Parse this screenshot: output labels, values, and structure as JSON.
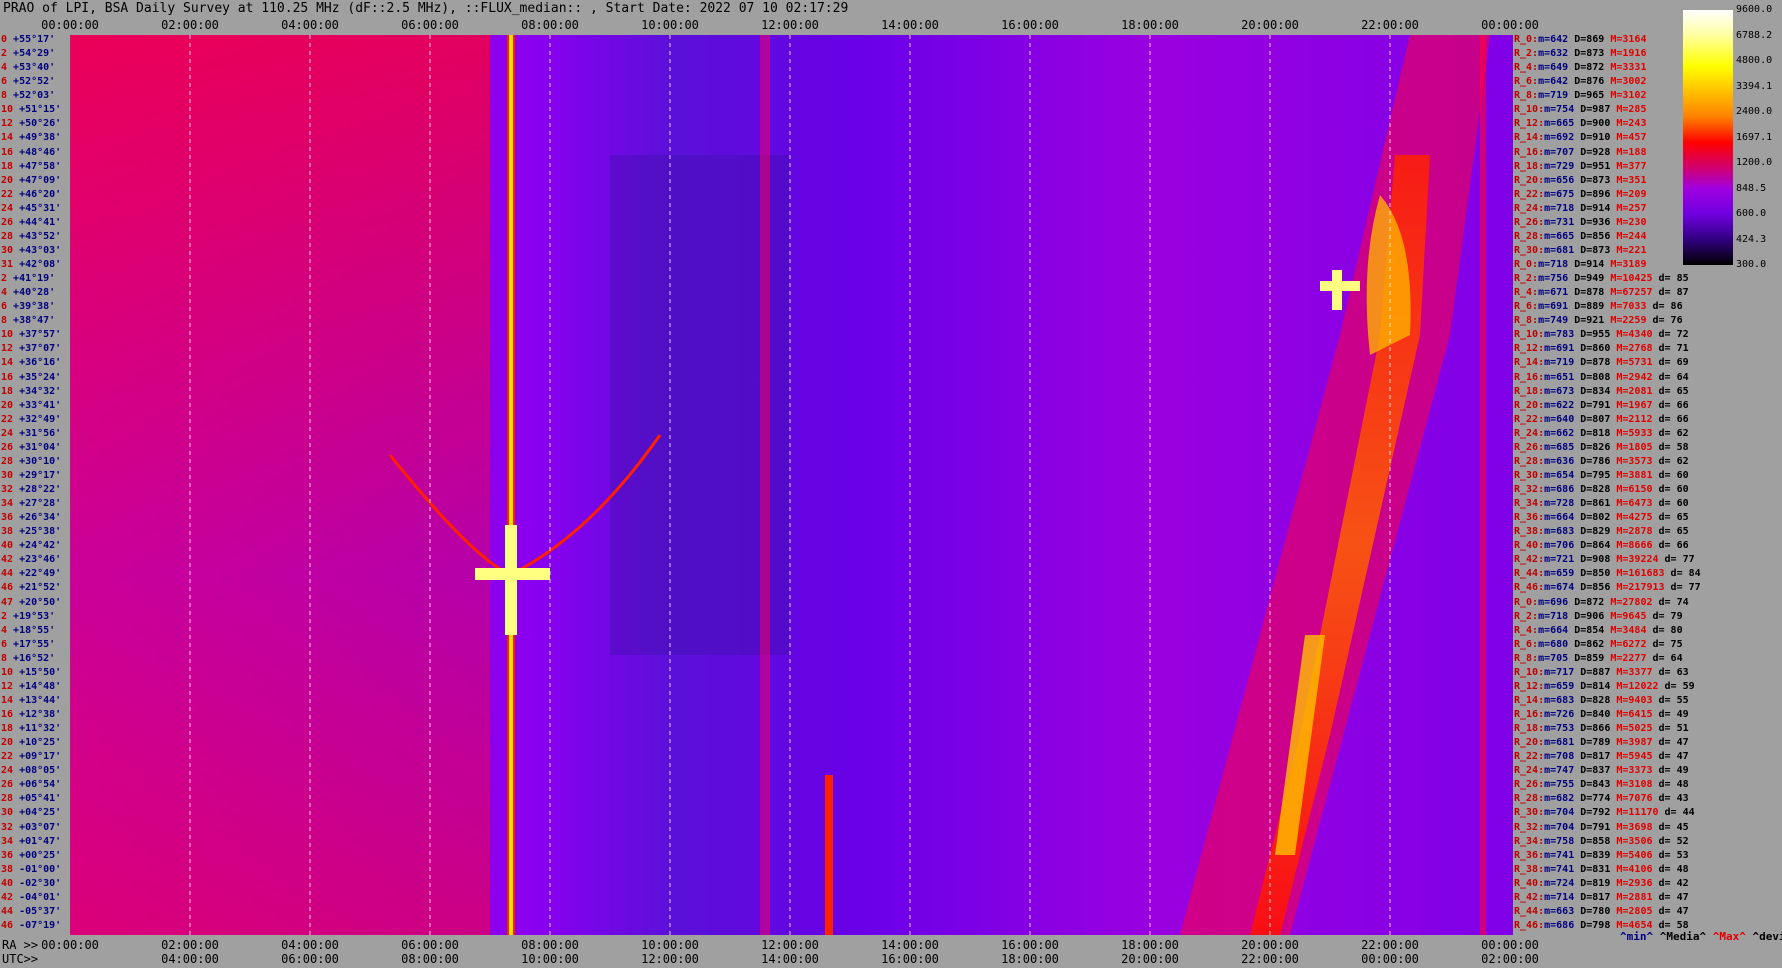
{
  "title": "PRAO of LPI, BSA Daily Survey at 110.25 MHz (dF::2.5 MHz), ::FLUX_median:: , Start Date: 2022 07 10 02:17:29",
  "chart_data": {
    "type": "heatmap",
    "title": "PRAO of LPI, BSA Daily Survey at 110.25 MHz (dF::2.5 MHz), ::FLUX_median:: , Start Date: 2022 07 10 02:17:29",
    "x_top_ticks": [
      "00:00:00",
      "02:00:00",
      "04:00:00",
      "06:00:00",
      "08:00:00",
      "10:00:00",
      "12:00:00",
      "14:00:00",
      "16:00:00",
      "18:00:00",
      "20:00:00",
      "22:00:00",
      "00:00:00"
    ],
    "x_ra_ticks": [
      "00:00:00",
      "02:00:00",
      "04:00:00",
      "06:00:00",
      "08:00:00",
      "10:00:00",
      "12:00:00",
      "14:00:00",
      "16:00:00",
      "18:00:00",
      "20:00:00",
      "22:00:00",
      "00:00:00",
      "02:00:00"
    ],
    "x_utc_ticks": [
      "04:00:00",
      "06:00:00",
      "08:00:00",
      "10:00:00",
      "12:00:00",
      "14:00:00",
      "16:00:00",
      "18:00:00",
      "20:00:00",
      "22:00:00",
      "00:00:00",
      "02:00:00"
    ],
    "ra_prefix": "RA >>",
    "utc_prefix": "UTC>>",
    "y_ticks": [
      {
        "n": "0",
        "d": "+55°17'"
      },
      {
        "n": "2",
        "d": "+54°29'"
      },
      {
        "n": "4",
        "d": "+53°40'"
      },
      {
        "n": "6",
        "d": "+52°52'"
      },
      {
        "n": "8",
        "d": "+52°03'"
      },
      {
        "n": "10",
        "d": "+51°15'"
      },
      {
        "n": "12",
        "d": "+50°26'"
      },
      {
        "n": "14",
        "d": "+49°38'"
      },
      {
        "n": "16",
        "d": "+48°46'"
      },
      {
        "n": "18",
        "d": "+47°58'"
      },
      {
        "n": "20",
        "d": "+47°09'"
      },
      {
        "n": "22",
        "d": "+46°20'"
      },
      {
        "n": "24",
        "d": "+45°31'"
      },
      {
        "n": "26",
        "d": "+44°41'"
      },
      {
        "n": "28",
        "d": "+43°52'"
      },
      {
        "n": "30",
        "d": "+43°03'"
      },
      {
        "n": "31",
        "d": "+42°08'"
      },
      {
        "n": "2",
        "d": "+41°19'"
      },
      {
        "n": "4",
        "d": "+40°28'"
      },
      {
        "n": "6",
        "d": "+39°38'"
      },
      {
        "n": "8",
        "d": "+38°47'"
      },
      {
        "n": "10",
        "d": "+37°57'"
      },
      {
        "n": "12",
        "d": "+37°07'"
      },
      {
        "n": "14",
        "d": "+36°16'"
      },
      {
        "n": "16",
        "d": "+35°24'"
      },
      {
        "n": "18",
        "d": "+34°32'"
      },
      {
        "n": "20",
        "d": "+33°41'"
      },
      {
        "n": "22",
        "d": "+32°49'"
      },
      {
        "n": "24",
        "d": "+31°56'"
      },
      {
        "n": "26",
        "d": "+31°04'"
      },
      {
        "n": "28",
        "d": "+30°10'"
      },
      {
        "n": "30",
        "d": "+29°17'"
      },
      {
        "n": "32",
        "d": "+28°22'"
      },
      {
        "n": "34",
        "d": "+27°28'"
      },
      {
        "n": "36",
        "d": "+26°34'"
      },
      {
        "n": "38",
        "d": "+25°38'"
      },
      {
        "n": "40",
        "d": "+24°42'"
      },
      {
        "n": "42",
        "d": "+23°46'"
      },
      {
        "n": "44",
        "d": "+22°49'"
      },
      {
        "n": "46",
        "d": "+21°52'"
      },
      {
        "n": "47",
        "d": "+20°50'"
      },
      {
        "n": "2",
        "d": "+19°53'"
      },
      {
        "n": "4",
        "d": "+18°55'"
      },
      {
        "n": "6",
        "d": "+17°55'"
      },
      {
        "n": "8",
        "d": "+16°52'"
      },
      {
        "n": "10",
        "d": "+15°50'"
      },
      {
        "n": "12",
        "d": "+14°48'"
      },
      {
        "n": "14",
        "d": "+13°44'"
      },
      {
        "n": "16",
        "d": "+12°38'"
      },
      {
        "n": "18",
        "d": "+11°32'"
      },
      {
        "n": "20",
        "d": "+10°25'"
      },
      {
        "n": "22",
        "d": "+09°17'"
      },
      {
        "n": "24",
        "d": "+08°05'"
      },
      {
        "n": "26",
        "d": "+06°54'"
      },
      {
        "n": "28",
        "d": "+05°41'"
      },
      {
        "n": "30",
        "d": "+04°25'"
      },
      {
        "n": "32",
        "d": "+03°07'"
      },
      {
        "n": "34",
        "d": "+01°47'"
      },
      {
        "n": "36",
        "d": "+00°25'"
      },
      {
        "n": "38",
        "d": "-01°00'"
      },
      {
        "n": "40",
        "d": "-02°30'"
      },
      {
        "n": "42",
        "d": "-04°01'"
      },
      {
        "n": "44",
        "d": "-05°37'"
      },
      {
        "n": "46",
        "d": "-07°19'"
      }
    ],
    "colorbar": {
      "ticks": [
        "9600.0",
        "6788.2",
        "4800.0",
        "3394.1",
        "2400.0",
        "1697.1",
        "1200.0",
        "848.5",
        "600.0",
        "424.3",
        "300.0"
      ],
      "colors": [
        "#ffffff",
        "#ffffa0",
        "#ffff00",
        "#ffc000",
        "#ff8000",
        "#ff0000",
        "#d00070",
        "#a000e0",
        "#7000e0",
        "#300080",
        "#000000"
      ]
    },
    "stats_legend": [
      "^min^",
      "^Media^",
      "^Max^",
      "^devia^"
    ],
    "stats": [
      {
        "r": "R_0:",
        "m": "642",
        "d": "869",
        "x": "3164",
        "dv": ""
      },
      {
        "r": "R_2:",
        "m": "632",
        "d": "873",
        "x": "1916",
        "dv": ""
      },
      {
        "r": "R_4:",
        "m": "649",
        "d": "872",
        "x": "3331",
        "dv": ""
      },
      {
        "r": "R_6:",
        "m": "642",
        "d": "876",
        "x": "3002",
        "dv": ""
      },
      {
        "r": "R_8:",
        "m": "719",
        "d": "965",
        "x": "3102",
        "dv": ""
      },
      {
        "r": "R_10:",
        "m": "754",
        "d": "987",
        "x": "285",
        "dv": ""
      },
      {
        "r": "R_12:",
        "m": "665",
        "d": "900",
        "x": "243",
        "dv": ""
      },
      {
        "r": "R_14:",
        "m": "692",
        "d": "910",
        "x": "457",
        "dv": ""
      },
      {
        "r": "R_16:",
        "m": "707",
        "d": "928",
        "x": "188",
        "dv": ""
      },
      {
        "r": "R_18:",
        "m": "729",
        "d": "951",
        "x": "377",
        "dv": ""
      },
      {
        "r": "R_20:",
        "m": "656",
        "d": "873",
        "x": "351",
        "dv": ""
      },
      {
        "r": "R_22:",
        "m": "675",
        "d": "896",
        "x": "209",
        "dv": ""
      },
      {
        "r": "R_24:",
        "m": "718",
        "d": "914",
        "x": "257",
        "dv": ""
      },
      {
        "r": "R_26:",
        "m": "731",
        "d": "936",
        "x": "230",
        "dv": ""
      },
      {
        "r": "R_28:",
        "m": "665",
        "d": "856",
        "x": "244",
        "dv": ""
      },
      {
        "r": "R_30:",
        "m": "681",
        "d": "873",
        "x": "221",
        "dv": ""
      },
      {
        "r": "R_0:",
        "m": "718",
        "d": "914",
        "x": "3189",
        "dv": ""
      },
      {
        "r": "R_2:",
        "m": "756",
        "d": "949",
        "x": "10425",
        "dv": "85"
      },
      {
        "r": "R_4:",
        "m": "671",
        "d": "878",
        "x": "67257",
        "dv": "87"
      },
      {
        "r": "R_6:",
        "m": "691",
        "d": "889",
        "x": "7033",
        "dv": "86"
      },
      {
        "r": "R_8:",
        "m": "749",
        "d": "921",
        "x": "2259",
        "dv": "76"
      },
      {
        "r": "R_10:",
        "m": "783",
        "d": "955",
        "x": "4340",
        "dv": "72"
      },
      {
        "r": "R_12:",
        "m": "691",
        "d": "860",
        "x": "2768",
        "dv": "71"
      },
      {
        "r": "R_14:",
        "m": "719",
        "d": "878",
        "x": "5731",
        "dv": "69"
      },
      {
        "r": "R_16:",
        "m": "651",
        "d": "808",
        "x": "2942",
        "dv": "64"
      },
      {
        "r": "R_18:",
        "m": "673",
        "d": "834",
        "x": "2081",
        "dv": "65"
      },
      {
        "r": "R_20:",
        "m": "622",
        "d": "791",
        "x": "1967",
        "dv": "66"
      },
      {
        "r": "R_22:",
        "m": "640",
        "d": "807",
        "x": "2112",
        "dv": "66"
      },
      {
        "r": "R_24:",
        "m": "662",
        "d": "818",
        "x": "5933",
        "dv": "62"
      },
      {
        "r": "R_26:",
        "m": "685",
        "d": "826",
        "x": "1805",
        "dv": "58"
      },
      {
        "r": "R_28:",
        "m": "636",
        "d": "786",
        "x": "3573",
        "dv": "62"
      },
      {
        "r": "R_30:",
        "m": "654",
        "d": "795",
        "x": "3881",
        "dv": "60"
      },
      {
        "r": "R_32:",
        "m": "686",
        "d": "828",
        "x": "6150",
        "dv": "60"
      },
      {
        "r": "R_34:",
        "m": "728",
        "d": "861",
        "x": "6473",
        "dv": "60"
      },
      {
        "r": "R_36:",
        "m": "664",
        "d": "802",
        "x": "4275",
        "dv": "65"
      },
      {
        "r": "R_38:",
        "m": "683",
        "d": "829",
        "x": "2878",
        "dv": "65"
      },
      {
        "r": "R_40:",
        "m": "706",
        "d": "864",
        "x": "8666",
        "dv": "66"
      },
      {
        "r": "R_42:",
        "m": "721",
        "d": "908",
        "x": "39224",
        "dv": "77"
      },
      {
        "r": "R_44:",
        "m": "659",
        "d": "850",
        "x": "161683",
        "dv": "84"
      },
      {
        "r": "R_46:",
        "m": "674",
        "d": "856",
        "x": "217913",
        "dv": "77"
      },
      {
        "r": "R_0:",
        "m": "696",
        "d": "872",
        "x": "27802",
        "dv": "74"
      },
      {
        "r": "R_2:",
        "m": "718",
        "d": "906",
        "x": "9645",
        "dv": "79"
      },
      {
        "r": "R_4:",
        "m": "664",
        "d": "854",
        "x": "3484",
        "dv": "80"
      },
      {
        "r": "R_6:",
        "m": "680",
        "d": "862",
        "x": "6272",
        "dv": "75"
      },
      {
        "r": "R_8:",
        "m": "705",
        "d": "859",
        "x": "2277",
        "dv": "64"
      },
      {
        "r": "R_10:",
        "m": "717",
        "d": "887",
        "x": "3377",
        "dv": "63"
      },
      {
        "r": "R_12:",
        "m": "659",
        "d": "814",
        "x": "12022",
        "dv": "59"
      },
      {
        "r": "R_14:",
        "m": "683",
        "d": "828",
        "x": "9403",
        "dv": "55"
      },
      {
        "r": "R_16:",
        "m": "726",
        "d": "840",
        "x": "6415",
        "dv": "49"
      },
      {
        "r": "R_18:",
        "m": "753",
        "d": "866",
        "x": "5025",
        "dv": "51"
      },
      {
        "r": "R_20:",
        "m": "681",
        "d": "789",
        "x": "3987",
        "dv": "47"
      },
      {
        "r": "R_22:",
        "m": "708",
        "d": "817",
        "x": "5945",
        "dv": "47"
      },
      {
        "r": "R_24:",
        "m": "747",
        "d": "837",
        "x": "3373",
        "dv": "49"
      },
      {
        "r": "R_26:",
        "m": "755",
        "d": "843",
        "x": "3108",
        "dv": "48"
      },
      {
        "r": "R_28:",
        "m": "682",
        "d": "774",
        "x": "7076",
        "dv": "43"
      },
      {
        "r": "R_30:",
        "m": "704",
        "d": "792",
        "x": "11170",
        "dv": "44"
      },
      {
        "r": "R_32:",
        "m": "704",
        "d": "791",
        "x": "3698",
        "dv": "45"
      },
      {
        "r": "R_34:",
        "m": "758",
        "d": "858",
        "x": "3506",
        "dv": "52"
      },
      {
        "r": "R_36:",
        "m": "741",
        "d": "839",
        "x": "5406",
        "dv": "53"
      },
      {
        "r": "R_38:",
        "m": "741",
        "d": "831",
        "x": "4106",
        "dv": "48"
      },
      {
        "r": "R_40:",
        "m": "724",
        "d": "819",
        "x": "2936",
        "dv": "42"
      },
      {
        "r": "R_42:",
        "m": "714",
        "d": "817",
        "x": "2881",
        "dv": "47"
      },
      {
        "r": "R_44:",
        "m": "663",
        "d": "780",
        "x": "2805",
        "dv": "47"
      },
      {
        "r": "R_46:",
        "m": "686",
        "d": "798",
        "x": "4654",
        "dv": "58"
      }
    ]
  }
}
